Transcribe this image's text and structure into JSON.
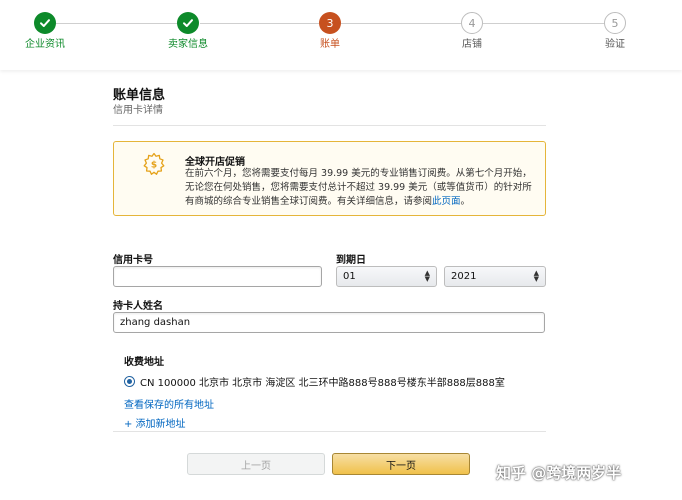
{
  "stepper": {
    "steps": [
      {
        "label": "企业资讯",
        "number": "",
        "state": "done"
      },
      {
        "label": "卖家信息",
        "number": "",
        "state": "done"
      },
      {
        "label": "账单",
        "number": "3",
        "state": "current"
      },
      {
        "label": "店铺",
        "number": "4",
        "state": "todo"
      },
      {
        "label": "验证",
        "number": "5",
        "state": "todo"
      }
    ]
  },
  "header": {
    "title": "账单信息",
    "subtitle": "信用卡详情"
  },
  "promo": {
    "title": "全球开店促销",
    "text": "在前六个月，您将需要支付每月 39.99 美元的专业销售订阅费。从第七个月开始，无论您在何处销售，您将需要支付总计不超过 39.99 美元（或等值货币）的针对所有商城的综合专业销售全球订阅费。有关详细信息，请参阅",
    "link": "此页面",
    "end": "。",
    "icon": "gear-badge-icon"
  },
  "form": {
    "card_number_label": "信用卡号",
    "card_number_value": "",
    "expiry_label": "到期日",
    "month_value": "01",
    "year_value": "2021",
    "holder_label": "持卡人姓名",
    "holder_value": "zhang dashan"
  },
  "billing": {
    "title": "收费地址",
    "address": "CN 100000 北京市 北京市 海淀区 北三环中路888号888号楼东半部888层888室",
    "view_all_link": "查看保存的所有地址",
    "add_new_link": "+ 添加新地址"
  },
  "buttons": {
    "prev": "上一页",
    "next": "下一页"
  },
  "watermark": "知乎 @跨境两岁半",
  "colors": {
    "done": "#0d8a2a",
    "current": "#c7511f",
    "link": "#0066c0",
    "promo_border": "#e5b53a",
    "next_button": "#f0c14b"
  }
}
